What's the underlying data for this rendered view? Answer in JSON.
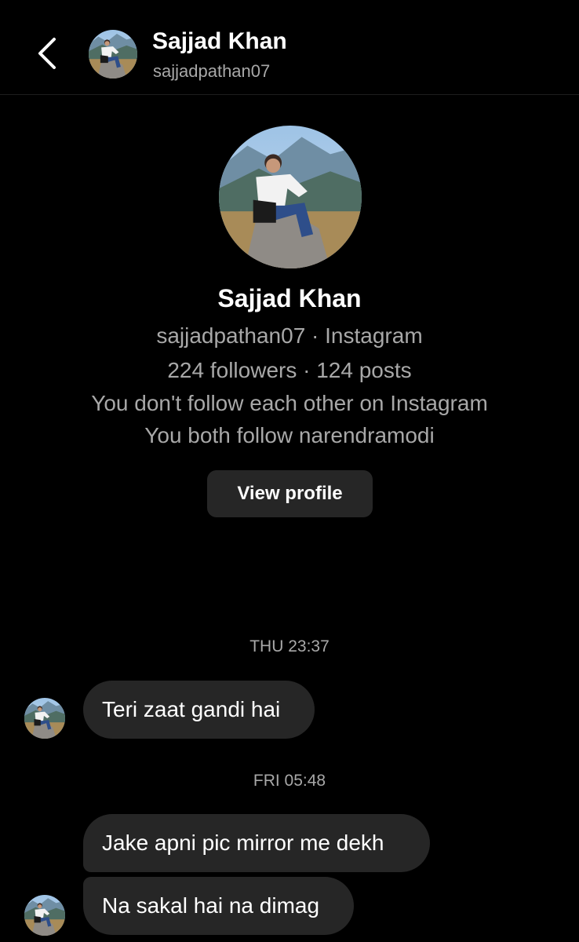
{
  "header": {
    "name": "Sajjad Khan",
    "username": "sajjadpathan07"
  },
  "profile": {
    "name": "Sajjad Khan",
    "username_platform": "sajjadpathan07 · Instagram",
    "stats": "224 followers · 124 posts",
    "follow_status": "You don't follow each other on Instagram",
    "mutual": "You both follow narendramodi",
    "view_profile_label": "View profile"
  },
  "messages": [
    {
      "timestamp": "THU 23:37",
      "texts": [
        "Teri zaat gandi hai"
      ]
    },
    {
      "timestamp": "FRI 05:48",
      "texts": [
        "Jake apni pic mirror me dekh",
        "Na sakal hai na dimag"
      ]
    }
  ],
  "icons": {
    "back": "chevron-left-icon",
    "avatar": "profile-photo"
  },
  "colors": {
    "background": "#000000",
    "primary_text": "#ffffff",
    "secondary_text": "#a8a8a8",
    "bubble": "#262626",
    "button": "#262626"
  }
}
